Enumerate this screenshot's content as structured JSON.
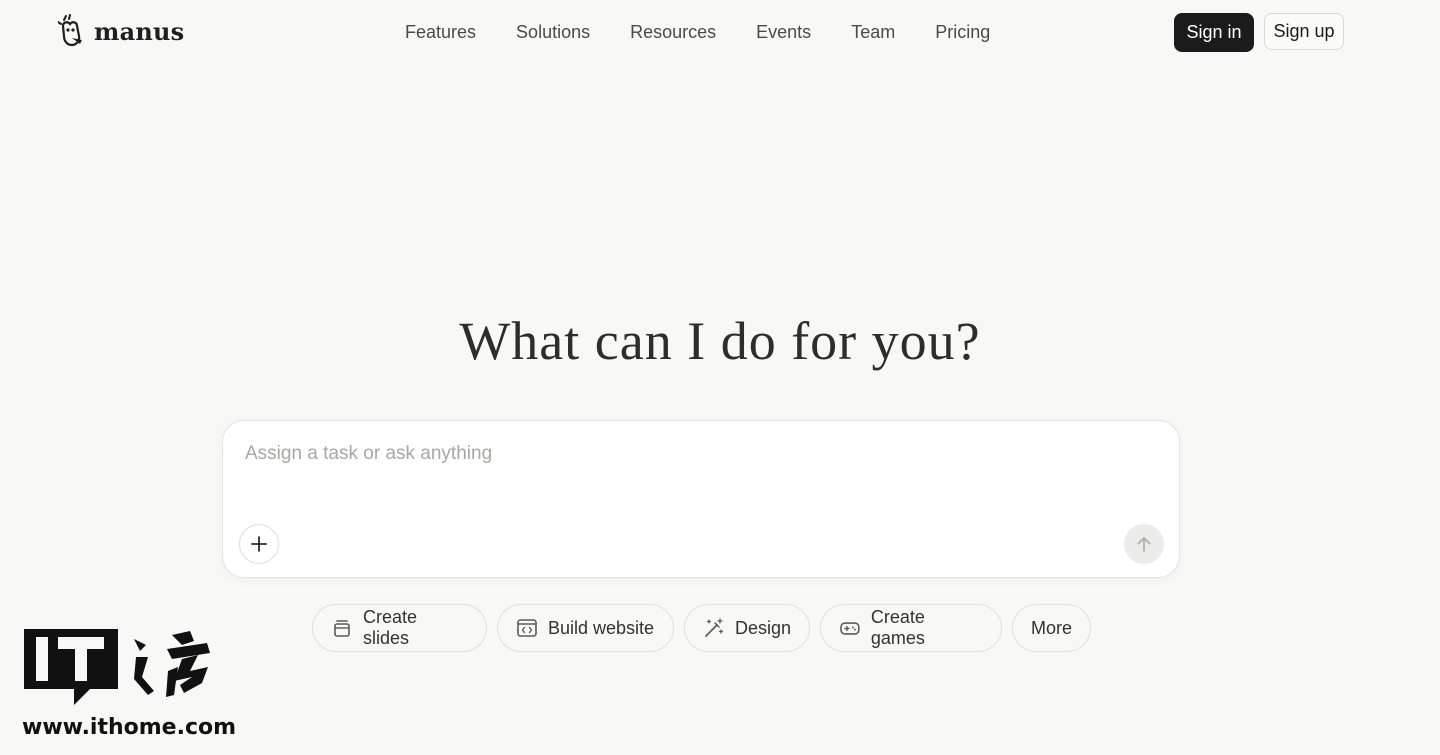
{
  "header": {
    "brand": "manus",
    "nav": [
      "Features",
      "Solutions",
      "Resources",
      "Events",
      "Team",
      "Pricing"
    ],
    "sign_in": "Sign in",
    "sign_up": "Sign up"
  },
  "hero": {
    "title": "What can I do for you?"
  },
  "task": {
    "placeholder": "Assign a task or ask anything",
    "value": ""
  },
  "quick_actions": [
    {
      "label": "Create slides",
      "icon": "slides-icon"
    },
    {
      "label": "Build website",
      "icon": "code-window-icon"
    },
    {
      "label": "Design",
      "icon": "magic-wand-icon"
    },
    {
      "label": "Create games",
      "icon": "gamepad-icon"
    },
    {
      "label": "More",
      "icon": ""
    }
  ],
  "watermark": {
    "url": "www.ithome.com"
  },
  "colors": {
    "background": "#f8f8f7",
    "primary_button": "#1b1b1b",
    "text": "#34322d"
  }
}
